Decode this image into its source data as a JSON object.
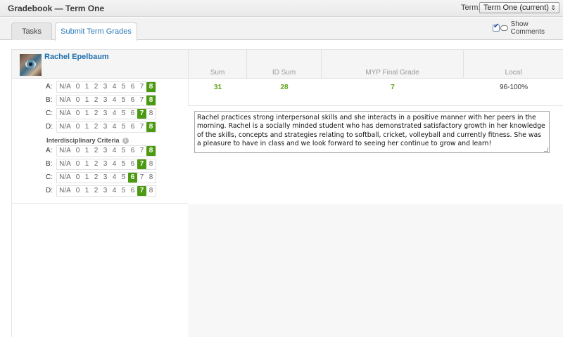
{
  "header": {
    "title": "Gradebook — Term One",
    "term_label": "Term:",
    "term_selected": "Term One (current)"
  },
  "tabs": [
    {
      "label": "Tasks",
      "active": false
    },
    {
      "label": "Submit Term Grades",
      "active": true
    }
  ],
  "show_comments": {
    "label": "Show Comments",
    "checked": true
  },
  "student": {
    "name": "Rachel Epelbaum"
  },
  "columns": {
    "sum": "Sum",
    "id_sum": "ID Sum",
    "myp_final": "MYP Final Grade",
    "local": "Local"
  },
  "summary": {
    "sum": "31",
    "id_sum": "28",
    "myp_final": "7",
    "local": "96-100%"
  },
  "scale_labels": [
    "N/A",
    "0",
    "1",
    "2",
    "3",
    "4",
    "5",
    "6",
    "7",
    "8"
  ],
  "criteria": [
    {
      "label": "A:",
      "selected": "8"
    },
    {
      "label": "B:",
      "selected": "8"
    },
    {
      "label": "C:",
      "selected": "7"
    },
    {
      "label": "D:",
      "selected": "8"
    }
  ],
  "interdisciplinary": {
    "title": "Interdisciplinary Criteria",
    "criteria": [
      {
        "label": "A:",
        "selected": "8"
      },
      {
        "label": "B:",
        "selected": "7"
      },
      {
        "label": "C:",
        "selected": "6"
      },
      {
        "label": "D:",
        "selected": "7"
      }
    ]
  },
  "comment": "Rachel practices strong interpersonal skills and she interacts in a positive manner with her peers in the morning. Rachel is a socially minded student who has demonstrated satisfactory growth in her knowledge of the skills, concepts and strategies relating to softball, cricket, volleyball and currently fitness. She was a pleasure to have in class and we look forward to seeing her continue to grow and learn!",
  "colors": {
    "accent_blue": "#1d6fae",
    "grade_green": "#4b9a12",
    "value_green": "#5aa412"
  }
}
